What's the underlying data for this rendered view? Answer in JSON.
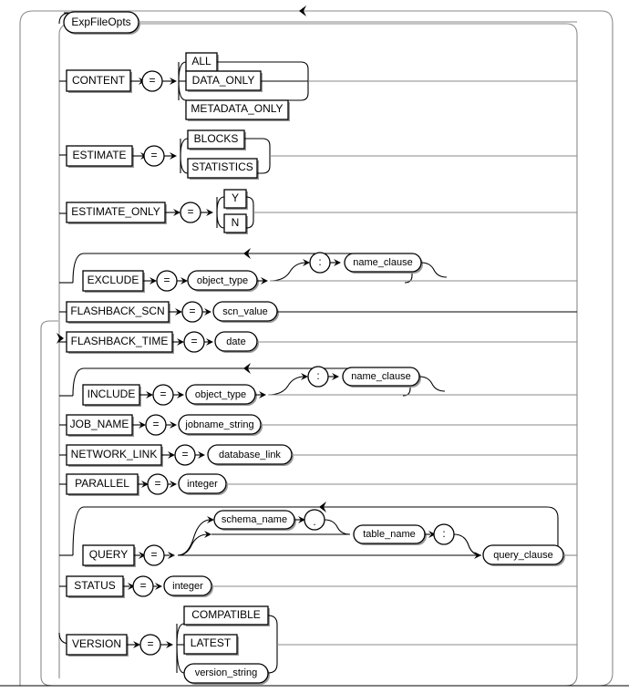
{
  "diagram": {
    "title": "ExpFileOpts",
    "type": "railroad-syntax-diagram",
    "entry_label": "ExpFileOpts",
    "colors": {
      "line": "#000000",
      "line_light": "#8a8a8a",
      "fill": "#ffffff",
      "shadow": "#9a9a9a"
    },
    "markers": {
      "arrow_left": "‹",
      "arrow_right": "›"
    },
    "rows": [
      {
        "id": "content",
        "keyword": "CONTENT",
        "operator": "=",
        "choices": [
          {
            "label": "ALL",
            "shape": "box"
          },
          {
            "label": "DATA_ONLY",
            "shape": "box"
          },
          {
            "label": "METADATA_ONLY",
            "shape": "box"
          }
        ]
      },
      {
        "id": "estimate",
        "keyword": "ESTIMATE",
        "operator": "=",
        "choices": [
          {
            "label": "BLOCKS",
            "shape": "box"
          },
          {
            "label": "STATISTICS",
            "shape": "box"
          }
        ]
      },
      {
        "id": "estimate-only",
        "keyword": "ESTIMATE_ONLY",
        "operator": "=",
        "choices": [
          {
            "label": "Y",
            "shape": "box"
          },
          {
            "label": "N",
            "shape": "box"
          }
        ]
      },
      {
        "id": "exclude",
        "keyword": "EXCLUDE",
        "operator": "=",
        "value": {
          "label": "object_type",
          "shape": "oval"
        },
        "optional_suffix": [
          {
            "label": ":",
            "shape": "circle"
          },
          {
            "label": "name_clause",
            "shape": "oval"
          }
        ],
        "loop": true
      },
      {
        "id": "flashback-scn",
        "keyword": "FLASHBACK_SCN",
        "operator": "=",
        "value": {
          "label": "scn_value",
          "shape": "oval"
        }
      },
      {
        "id": "flashback-time",
        "keyword": "FLASHBACK_TIME",
        "operator": "=",
        "value": {
          "label": "date",
          "shape": "oval"
        }
      },
      {
        "id": "include",
        "keyword": "INCLUDE",
        "operator": "=",
        "value": {
          "label": "object_type",
          "shape": "oval"
        },
        "optional_suffix": [
          {
            "label": ":",
            "shape": "circle"
          },
          {
            "label": "name_clause",
            "shape": "oval"
          }
        ],
        "loop": true
      },
      {
        "id": "job-name",
        "keyword": "JOB_NAME",
        "operator": "=",
        "value": {
          "label": "jobname_string",
          "shape": "oval"
        }
      },
      {
        "id": "network-link",
        "keyword": "NETWORK_LINK",
        "operator": "=",
        "value": {
          "label": "database_link",
          "shape": "oval"
        }
      },
      {
        "id": "parallel",
        "keyword": "PARALLEL",
        "operator": "=",
        "value": {
          "label": "integer",
          "shape": "oval"
        }
      },
      {
        "id": "query",
        "keyword": "QUERY",
        "operator": "=",
        "parts": [
          {
            "label": "schema_name",
            "shape": "oval"
          },
          {
            "label": ".",
            "shape": "circle"
          },
          {
            "label": "table_name",
            "shape": "oval"
          },
          {
            "label": ":",
            "shape": "circle"
          },
          {
            "label": "query_clause",
            "shape": "oval"
          }
        ],
        "loop": true
      },
      {
        "id": "status",
        "keyword": "STATUS",
        "operator": "=",
        "value": {
          "label": "integer",
          "shape": "oval"
        }
      },
      {
        "id": "version",
        "keyword": "VERSION",
        "operator": "=",
        "choices": [
          {
            "label": "COMPATIBLE",
            "shape": "box"
          },
          {
            "label": "LATEST",
            "shape": "box"
          },
          {
            "label": "version_string",
            "shape": "oval"
          }
        ]
      }
    ]
  }
}
